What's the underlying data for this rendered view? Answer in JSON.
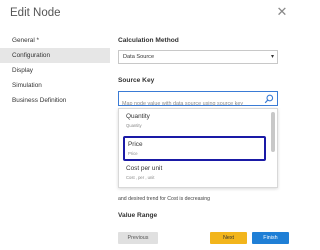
{
  "dialog": {
    "title": "Edit Node",
    "close_glyph": "✕"
  },
  "sidebar": {
    "items": [
      {
        "label": "General *"
      },
      {
        "label": "Configuration"
      },
      {
        "label": "Display"
      },
      {
        "label": "Simulation"
      },
      {
        "label": "Business Definition"
      }
    ],
    "active_index": 1
  },
  "main": {
    "calculation_method": {
      "label": "Calculation Method",
      "value": "Data Source",
      "caret": "▾"
    },
    "source_key": {
      "label": "Source Key",
      "search_placeholder": "Map node value with data source using source key",
      "search_icon": "search-icon",
      "options": [
        {
          "name": "Quantity",
          "sub": "Quantity"
        },
        {
          "name": "Price",
          "sub": "Price",
          "highlighted": true
        },
        {
          "name": "Cost per unit",
          "sub": "Cost , per , unit"
        }
      ]
    },
    "trend_note": "and desired trend for Cost is decreasing",
    "value_range_label": "Value Range"
  },
  "footer": {
    "previous_label": "Previous",
    "next_label": "Next",
    "finish_label": "Finish"
  },
  "colors": {
    "highlight_border": "#1a1aa6",
    "next_button": "#f2b51c",
    "finish_button": "#1f7fd6",
    "active_sidebar": "#e6e6e6"
  }
}
